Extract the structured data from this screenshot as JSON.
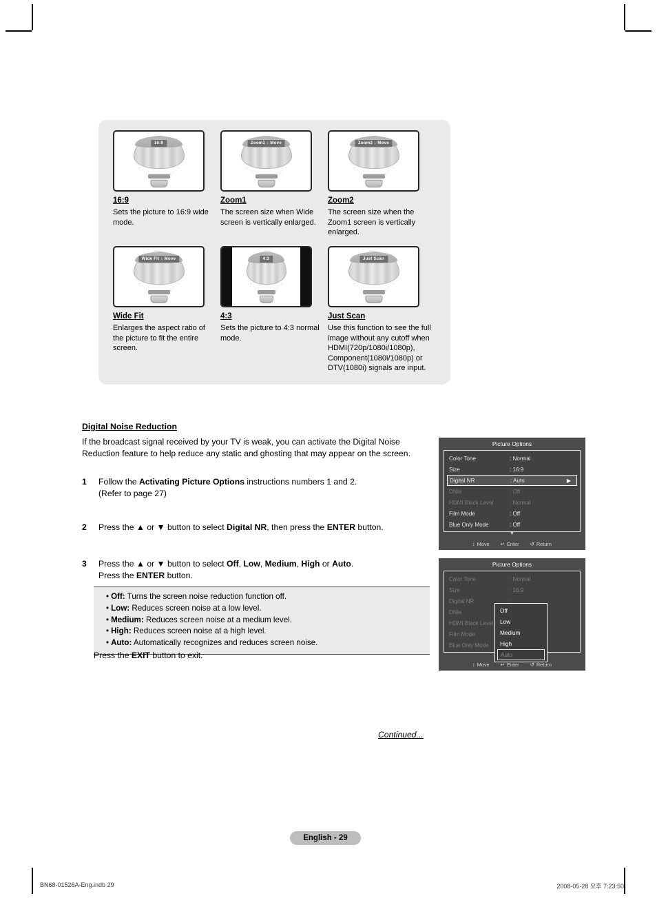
{
  "aspect_panel": {
    "cards": [
      {
        "tv_label": "16:9",
        "title": "16:9",
        "desc": "Sets the picture to 16:9 wide mode.",
        "style": "wide"
      },
      {
        "tv_label": "Zoom1 ↕ Move",
        "title": "Zoom1",
        "desc": "The screen size when Wide screen is vertically enlarged.",
        "style": "wide"
      },
      {
        "tv_label": "Zoom2 ↕ Move",
        "title": "Zoom2",
        "desc": "The screen size when the Zoom1 screen is vertically enlarged.",
        "style": "wide"
      },
      {
        "tv_label": "Wide Fit ↕ Move",
        "title": "Wide Fit",
        "desc": "Enlarges the aspect ratio of the picture to fit the entire screen.",
        "style": "wide"
      },
      {
        "tv_label": "4:3",
        "title": "4:3",
        "desc": "Sets the picture to 4:3 normal mode.",
        "style": "pillar"
      },
      {
        "tv_label": "Just Scan",
        "title": "Just Scan",
        "desc": "Use this function to see the full image without any cutoff when HDMI(720p/1080i/1080p), Component(1080i/1080p) or DTV(1080i) signals are input.",
        "style": "wide"
      }
    ]
  },
  "dnr": {
    "heading": "Digital Noise Reduction",
    "intro": "If the broadcast signal received by your TV is weak, you can activate the Digital Noise Reduction feature to help reduce any static and ghosting that may appear on the screen.",
    "steps": [
      {
        "num": "1",
        "parts": [
          {
            "t": "Follow the ",
            "b": false
          },
          {
            "t": "Activating Picture Options",
            "b": true
          },
          {
            "t": " instructions numbers 1 and 2.\n(Refer to page 27)",
            "b": false
          }
        ]
      },
      {
        "num": "2",
        "parts": [
          {
            "t": "Press the ▲ or ▼ button to select ",
            "b": false
          },
          {
            "t": "Digital NR",
            "b": true
          },
          {
            "t": ", then press the ",
            "b": false
          },
          {
            "t": "ENTER",
            "b": true
          },
          {
            "t": " button.",
            "b": false
          }
        ]
      },
      {
        "num": "3",
        "parts": [
          {
            "t": "Press the ▲ or ▼ button to select ",
            "b": false
          },
          {
            "t": "Off",
            "b": true
          },
          {
            "t": ", ",
            "b": false
          },
          {
            "t": "Low",
            "b": true
          },
          {
            "t": ", ",
            "b": false
          },
          {
            "t": "Medium",
            "b": true
          },
          {
            "t": ", ",
            "b": false
          },
          {
            "t": "High",
            "b": true
          },
          {
            "t": " or ",
            "b": false
          },
          {
            "t": "Auto",
            "b": true
          },
          {
            "t": ".\nPress the ",
            "b": false
          },
          {
            "t": "ENTER",
            "b": true
          },
          {
            "t": " button.",
            "b": false
          }
        ]
      }
    ],
    "notes": [
      {
        "term": "Off:",
        "text": " Turns the screen noise reduction function off."
      },
      {
        "term": "Low:",
        "text": " Reduces screen noise at a low level."
      },
      {
        "term": "Medium:",
        "text": " Reduces screen noise at a medium level."
      },
      {
        "term": "High:",
        "text": " Reduces screen noise at a high level."
      },
      {
        "term": "Auto:",
        "text": " Automatically recognizes and reduces screen noise."
      }
    ],
    "exit_parts": [
      {
        "t": "Press the ",
        "b": false
      },
      {
        "t": "EXIT",
        "b": true
      },
      {
        "t": " button to exit.",
        "b": false
      }
    ]
  },
  "continued": "Continued...",
  "osd_top": {
    "title": "Picture Options",
    "rows": [
      {
        "name": "Color Tone",
        "value": ": Normal",
        "dim": false,
        "selected": false,
        "arrow": false
      },
      {
        "name": "Size",
        "value": ": 16:9",
        "dim": false,
        "selected": false,
        "arrow": false
      },
      {
        "name": "Digital NR",
        "value": ": Auto",
        "dim": false,
        "selected": true,
        "arrow": true
      },
      {
        "name": "DNIe",
        "value": ": Off",
        "dim": true,
        "selected": false,
        "arrow": false
      },
      {
        "name": "HDMI Black Level",
        "value": ": Normal",
        "dim": true,
        "selected": false,
        "arrow": false
      },
      {
        "name": "Film Mode",
        "value": ": Off",
        "dim": false,
        "selected": false,
        "arrow": false
      },
      {
        "name": "Blue Only Mode",
        "value": ": Off",
        "dim": false,
        "selected": false,
        "arrow": false
      }
    ],
    "scroll_caret": "▼",
    "footer": [
      {
        "icon": "↕",
        "label": "Move"
      },
      {
        "icon": "↵",
        "label": "Enter"
      },
      {
        "icon": "↺",
        "label": "Return"
      }
    ]
  },
  "osd_bottom": {
    "title": "Picture Options",
    "rows": [
      {
        "name": "Color Tone",
        "value": ": Normal",
        "dim": true,
        "selected": false,
        "arrow": false
      },
      {
        "name": "Size",
        "value": ": 16:9",
        "dim": true,
        "selected": false,
        "arrow": false
      },
      {
        "name": "Digital NR",
        "value": ":",
        "dim": true,
        "selected": false,
        "arrow": false
      },
      {
        "name": "DNIe",
        "value": ":",
        "dim": true,
        "selected": false,
        "arrow": false
      },
      {
        "name": "HDMI Black Level",
        "value": ":",
        "dim": true,
        "selected": false,
        "arrow": false
      },
      {
        "name": "Film Mode",
        "value": ":",
        "dim": true,
        "selected": false,
        "arrow": false
      },
      {
        "name": "Blue Only Mode",
        "value": ":",
        "dim": true,
        "selected": false,
        "arrow": false
      }
    ],
    "dropdown": [
      {
        "label": "Off",
        "selected": false
      },
      {
        "label": "Low",
        "selected": false
      },
      {
        "label": "Medium",
        "selected": false
      },
      {
        "label": "High",
        "selected": false
      },
      {
        "label": "Auto",
        "selected": true
      }
    ],
    "footer": [
      {
        "icon": "↕",
        "label": "Move"
      },
      {
        "icon": "↵",
        "label": "Enter"
      },
      {
        "icon": "↺",
        "label": "Return"
      }
    ]
  },
  "page_badge": "English - 29",
  "footer": {
    "left": "BN68-01526A-Eng.indb   29",
    "right": "2008-05-28   오후 7:23:50"
  }
}
